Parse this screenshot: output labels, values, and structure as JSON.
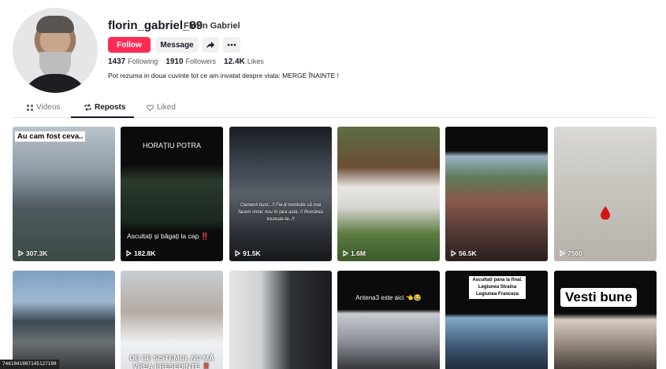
{
  "profile": {
    "username": "florin_gabriel_89",
    "nickname": "Florin Gabriel",
    "follow_label": "Follow",
    "message_label": "Message",
    "following_count": "1437",
    "following_label": "Following",
    "followers_count": "1910",
    "followers_label": "Followers",
    "likes_count": "12.4K",
    "likes_label": "Likes",
    "bio": "Pot rezuma in doua cuvinte tot ce am invatat despre viata: MERGE ÎNAINTE !"
  },
  "tabs": [
    {
      "label": "Videos",
      "icon": "grid-icon"
    },
    {
      "label": "Reposts",
      "icon": "repost-icon",
      "active": true
    },
    {
      "label": "Liked",
      "icon": "heart-icon"
    }
  ],
  "videos": [
    {
      "views": "307.3K",
      "caption": "Au cam fost ceva.."
    },
    {
      "views": "182.8K",
      "caption": "HORAȚIU POTRA",
      "caption2": "Ascultați și băgați la cap ‼️"
    },
    {
      "views": "91.5K",
      "caption": "Oamenii buni...!! Fie-ți revoluție că mai facem nimic nou în țara asta..!! România trezește-te..!!"
    },
    {
      "views": "1.6M",
      "caption": ""
    },
    {
      "views": "56.5K",
      "caption": ""
    },
    {
      "views": "7560",
      "caption": ""
    },
    {
      "views": "",
      "caption": ""
    },
    {
      "views": "",
      "caption": "DE CE SISTEMUL NU MĂ VREA PREȘEDINTE ‼️"
    },
    {
      "views": "",
      "caption": ""
    },
    {
      "views": "",
      "caption": "Antena3 este aici 👈😂"
    },
    {
      "views": "",
      "caption": "Ascultați pana la final. Legiunea Straina Legiunea Franceza"
    },
    {
      "views": "",
      "caption": "Vesti bune"
    }
  ],
  "overlay_id": "7461041007145127190"
}
